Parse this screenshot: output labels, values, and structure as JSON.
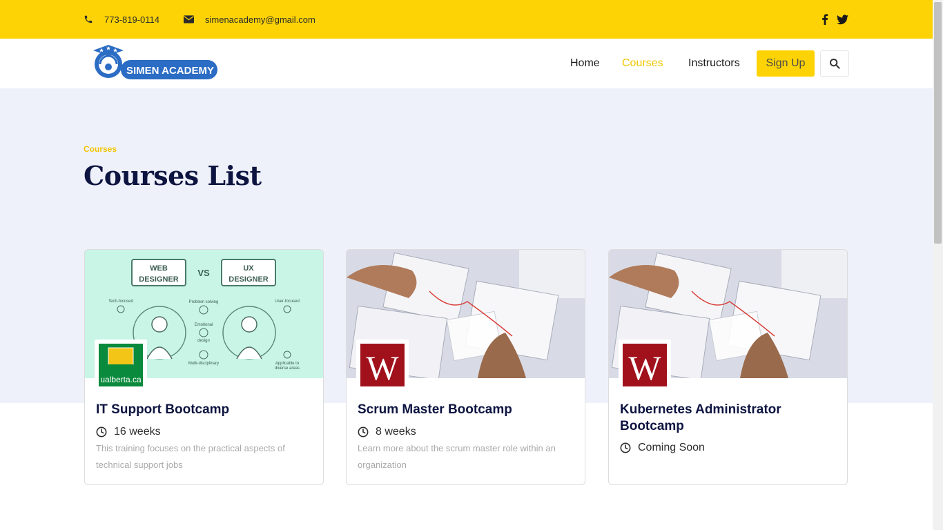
{
  "topbar": {
    "phone": "773-819-0114",
    "email": "simenacademy@gmail.com",
    "social": [
      "facebook-icon",
      "twitter-icon"
    ]
  },
  "brand": {
    "logo_text": "SIMEN ACADEMY",
    "colors": {
      "yellow": "#fdd305",
      "navy": "#0d1440",
      "logo_blue": "#2b6cc4"
    }
  },
  "nav": {
    "items": [
      {
        "label": "Home",
        "active": false
      },
      {
        "label": "Courses",
        "active": true
      },
      {
        "label": "Instructors",
        "active": false
      }
    ],
    "signup_label": "Sign Up",
    "search_icon": "search-icon"
  },
  "hero": {
    "eyebrow": "Courses",
    "title": "Courses List"
  },
  "courses": [
    {
      "title": "IT Support Bootcamp",
      "duration": "16 weeks",
      "description": "This training focuses on the practical aspects of technical support jobs",
      "badge_text": "ualberta.ca",
      "thumb": {
        "left_box": "WEB DESIGNER",
        "vs": "VS",
        "right_box": "UX DESIGNER",
        "labels": [
          "Tech-focused",
          "Problem solving",
          "User-focused",
          "Emotional design",
          "Multi-disciplinary",
          "Applicable to diverse areas"
        ]
      }
    },
    {
      "title": "Scrum Master Bootcamp",
      "duration": "8 weeks",
      "description": "Learn more about the scrum master role within an organization",
      "badge_text": "W"
    },
    {
      "title": "Kubernetes Administrator Bootcamp",
      "duration": "Coming Soon",
      "description": "",
      "badge_text": "W"
    }
  ]
}
